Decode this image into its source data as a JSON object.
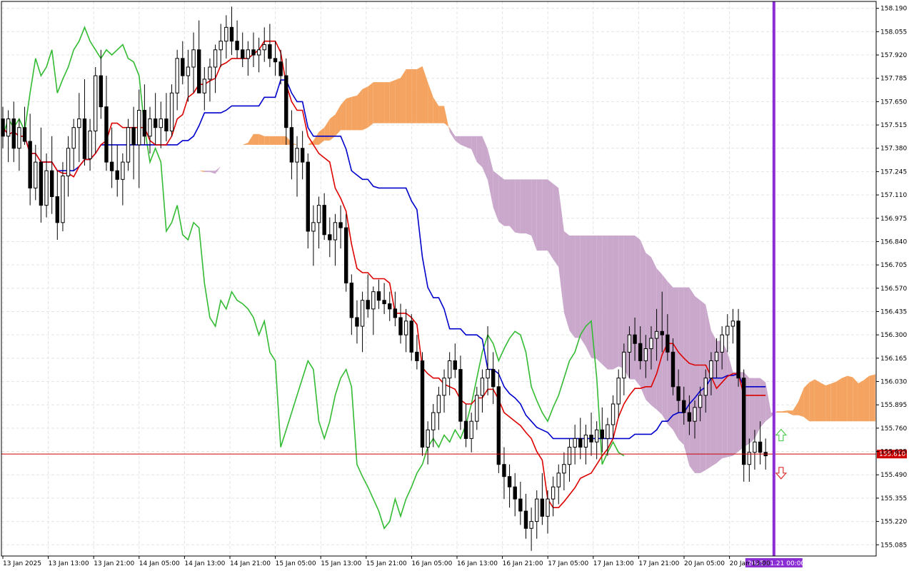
{
  "chart_data": {
    "type": "candlestick",
    "symbol_note": "",
    "y_axis": {
      "min": 155.02,
      "max": 158.23,
      "ticks": [
        "158.190",
        "158.055",
        "157.920",
        "157.785",
        "157.650",
        "157.515",
        "157.380",
        "157.245",
        "157.110",
        "156.975",
        "156.840",
        "156.705",
        "156.570",
        "156.435",
        "156.300",
        "156.165",
        "156.030",
        "155.895",
        "155.760",
        "155.625",
        "155.490",
        "155.355",
        "155.220",
        "155.085"
      ]
    },
    "x_axis": {
      "ticks": [
        "13 Jan 2025",
        "13 Jan 13:00",
        "13 Jan 21:00",
        "14 Jan 05:00",
        "14 Jan 13:00",
        "14 Jan 21:00",
        "15 Jan 05:00",
        "15 Jan 13:00",
        "15 Jan 21:00",
        "16 Jan 05:00",
        "16 Jan 13:00",
        "16 Jan 21:00",
        "17 Jan 05:00",
        "17 Jan 13:00",
        "17 Jan 21:00",
        "20 Jan 05:00",
        "20 Jan 13:00"
      ]
    },
    "current_price": "155.610",
    "current_price_color": "#cc0000",
    "future_marker": {
      "label": "2025.01.21 00:00",
      "color": "#8b2fd4"
    },
    "grid": true,
    "colors": {
      "bull_candle": "#ffffff",
      "bear_candle": "#000000",
      "tenkan": "#dd0000",
      "kijun": "#0000cc",
      "chikou": "#33bb33",
      "cloud_bear": "#c9a8cc",
      "cloud_bull": "#f4a460",
      "arrow_up": "#55cc55",
      "arrow_down": "#dd3333"
    },
    "candles": [
      [
        157.55,
        157.62,
        157.38,
        157.45
      ],
      [
        157.45,
        157.6,
        157.3,
        157.55
      ],
      [
        157.55,
        157.65,
        157.3,
        157.38
      ],
      [
        157.38,
        157.55,
        157.25,
        157.5
      ],
      [
        157.5,
        157.62,
        157.4,
        157.42
      ],
      [
        157.42,
        157.58,
        157.05,
        157.15
      ],
      [
        157.15,
        157.4,
        157.08,
        157.3
      ],
      [
        157.3,
        157.5,
        156.95,
        157.05
      ],
      [
        157.05,
        157.35,
        156.98,
        157.25
      ],
      [
        157.25,
        157.45,
        157.0,
        157.1
      ],
      [
        157.1,
        157.25,
        156.85,
        156.95
      ],
      [
        156.95,
        157.3,
        156.9,
        157.22
      ],
      [
        157.22,
        157.45,
        157.1,
        157.38
      ],
      [
        157.38,
        157.55,
        157.25,
        157.5
      ],
      [
        157.5,
        157.7,
        157.3,
        157.55
      ],
      [
        157.55,
        157.78,
        157.28,
        157.32
      ],
      [
        157.32,
        157.55,
        157.25,
        157.48
      ],
      [
        157.48,
        157.85,
        157.35,
        157.8
      ],
      [
        157.8,
        157.95,
        157.55,
        157.62
      ],
      [
        157.62,
        157.8,
        157.25,
        157.3
      ],
      [
        157.3,
        157.5,
        157.15,
        157.25
      ],
      [
        157.25,
        157.4,
        157.1,
        157.2
      ],
      [
        157.2,
        157.35,
        157.05,
        157.3
      ],
      [
        157.3,
        157.55,
        157.25,
        157.5
      ],
      [
        157.5,
        157.62,
        157.2,
        157.4
      ],
      [
        157.4,
        157.72,
        157.15,
        157.6
      ],
      [
        157.6,
        157.75,
        157.4,
        157.45
      ],
      [
        157.45,
        157.62,
        157.35,
        157.55
      ],
      [
        157.55,
        157.7,
        157.4,
        157.5
      ],
      [
        157.5,
        157.65,
        157.38,
        157.55
      ],
      [
        157.55,
        157.7,
        157.42,
        157.48
      ],
      [
        157.48,
        157.75,
        157.45,
        157.7
      ],
      [
        157.7,
        157.95,
        157.6,
        157.9
      ],
      [
        157.9,
        158.0,
        157.75,
        157.8
      ],
      [
        157.8,
        157.95,
        157.65,
        157.85
      ],
      [
        157.85,
        158.05,
        157.7,
        157.95
      ],
      [
        157.95,
        158.12,
        157.8,
        157.7
      ],
      [
        157.7,
        157.85,
        157.6,
        157.78
      ],
      [
        157.78,
        157.9,
        157.65,
        157.85
      ],
      [
        157.85,
        157.98,
        157.7,
        157.95
      ],
      [
        157.95,
        158.1,
        157.85,
        158.0
      ],
      [
        158.0,
        158.15,
        157.9,
        158.08
      ],
      [
        158.08,
        158.2,
        157.92,
        158.0
      ],
      [
        158.0,
        158.12,
        157.9,
        157.95
      ],
      [
        157.95,
        158.05,
        157.85,
        157.9
      ],
      [
        157.9,
        158.0,
        157.8,
        157.95
      ],
      [
        157.95,
        158.05,
        157.85,
        157.92
      ],
      [
        157.92,
        158.02,
        157.82,
        157.95
      ],
      [
        157.95,
        158.08,
        157.88,
        157.98
      ],
      [
        157.98,
        158.1,
        157.85,
        157.9
      ],
      [
        157.9,
        158.0,
        157.8,
        157.88
      ],
      [
        157.88,
        157.95,
        157.75,
        157.8
      ],
      [
        157.8,
        157.9,
        157.4,
        157.5
      ],
      [
        157.5,
        157.6,
        157.2,
        157.3
      ],
      [
        157.3,
        157.45,
        157.1,
        157.38
      ],
      [
        157.38,
        157.48,
        157.2,
        157.3
      ],
      [
        157.3,
        157.35,
        156.8,
        156.9
      ],
      [
        156.9,
        157.05,
        156.7,
        156.95
      ],
      [
        156.95,
        157.1,
        156.8,
        157.05
      ],
      [
        157.05,
        157.12,
        156.85,
        156.88
      ],
      [
        156.88,
        156.98,
        156.75,
        156.85
      ],
      [
        156.85,
        157.0,
        156.7,
        156.95
      ],
      [
        156.95,
        157.05,
        156.8,
        156.92
      ],
      [
        156.92,
        157.0,
        156.55,
        156.6
      ],
      [
        156.6,
        156.65,
        156.3,
        156.4
      ],
      [
        156.4,
        156.5,
        156.25,
        156.35
      ],
      [
        156.35,
        156.55,
        156.2,
        156.5
      ],
      [
        156.5,
        156.65,
        156.4,
        156.45
      ],
      [
        156.45,
        156.58,
        156.3,
        156.55
      ],
      [
        156.55,
        156.62,
        156.45,
        156.5
      ],
      [
        156.5,
        156.6,
        156.42,
        156.48
      ],
      [
        156.48,
        156.55,
        156.38,
        156.45
      ],
      [
        156.45,
        156.55,
        156.35,
        156.4
      ],
      [
        156.4,
        156.48,
        156.25,
        156.3
      ],
      [
        156.3,
        156.45,
        156.2,
        156.38
      ],
      [
        156.38,
        156.42,
        156.15,
        156.2
      ],
      [
        156.2,
        156.3,
        156.1,
        156.15
      ],
      [
        156.15,
        156.2,
        155.6,
        155.65
      ],
      [
        155.65,
        155.8,
        155.55,
        155.75
      ],
      [
        155.75,
        155.9,
        155.65,
        155.85
      ],
      [
        155.85,
        156.0,
        155.75,
        155.95
      ],
      [
        155.95,
        156.1,
        155.85,
        156.05
      ],
      [
        156.05,
        156.2,
        155.95,
        156.15
      ],
      [
        156.15,
        156.25,
        156.05,
        156.1
      ],
      [
        156.1,
        156.18,
        155.75,
        155.8
      ],
      [
        155.8,
        155.9,
        155.65,
        155.7
      ],
      [
        155.7,
        155.85,
        155.62,
        155.8
      ],
      [
        155.8,
        156.0,
        155.75,
        155.95
      ],
      [
        155.95,
        156.1,
        155.85,
        156.05
      ],
      [
        156.05,
        156.35,
        155.95,
        156.1
      ],
      [
        156.1,
        156.2,
        155.9,
        156.0
      ],
      [
        156.0,
        156.1,
        155.5,
        155.55
      ],
      [
        155.55,
        155.65,
        155.35,
        155.48
      ],
      [
        155.48,
        155.55,
        155.3,
        155.42
      ],
      [
        155.42,
        155.5,
        155.25,
        155.35
      ],
      [
        155.35,
        155.45,
        155.2,
        155.28
      ],
      [
        155.28,
        155.38,
        155.12,
        155.18
      ],
      [
        155.18,
        155.3,
        155.05,
        155.22
      ],
      [
        155.22,
        155.4,
        155.12,
        155.35
      ],
      [
        155.35,
        155.5,
        155.2,
        155.25
      ],
      [
        155.25,
        155.4,
        155.15,
        155.35
      ],
      [
        155.35,
        155.48,
        155.25,
        155.42
      ],
      [
        155.42,
        155.55,
        155.32,
        155.5
      ],
      [
        155.5,
        155.62,
        155.4,
        155.55
      ],
      [
        155.55,
        155.7,
        155.45,
        155.65
      ],
      [
        155.65,
        155.78,
        155.55,
        155.7
      ],
      [
        155.7,
        155.82,
        155.58,
        155.65
      ],
      [
        155.65,
        155.78,
        155.55,
        155.72
      ],
      [
        155.72,
        155.85,
        155.6,
        155.68
      ],
      [
        155.68,
        155.8,
        155.58,
        155.75
      ],
      [
        155.75,
        155.88,
        155.62,
        155.7
      ],
      [
        155.7,
        155.82,
        155.6,
        155.78
      ],
      [
        155.78,
        155.95,
        155.7,
        155.9
      ],
      [
        155.9,
        156.1,
        155.82,
        156.05
      ],
      [
        156.05,
        156.25,
        155.95,
        156.2
      ],
      [
        156.2,
        156.35,
        156.05,
        156.3
      ],
      [
        156.3,
        156.4,
        156.15,
        156.25
      ],
      [
        156.25,
        156.35,
        156.1,
        156.15
      ],
      [
        156.15,
        156.3,
        156.05,
        156.22
      ],
      [
        156.22,
        156.35,
        156.1,
        156.28
      ],
      [
        156.28,
        156.45,
        156.15,
        156.32
      ],
      [
        156.32,
        156.55,
        156.2,
        156.3
      ],
      [
        156.3,
        156.42,
        156.15,
        156.2
      ],
      [
        156.2,
        156.28,
        155.95,
        156.0
      ],
      [
        156.0,
        156.1,
        155.85,
        155.92
      ],
      [
        155.92,
        156.0,
        155.78,
        155.85
      ],
      [
        155.85,
        155.95,
        155.72,
        155.8
      ],
      [
        155.8,
        155.92,
        155.7,
        155.88
      ],
      [
        155.88,
        156.0,
        155.8,
        155.95
      ],
      [
        155.95,
        156.1,
        155.85,
        156.05
      ],
      [
        156.05,
        156.2,
        155.95,
        156.15
      ],
      [
        156.15,
        156.28,
        156.05,
        156.2
      ],
      [
        156.2,
        156.35,
        156.1,
        156.3
      ],
      [
        156.3,
        156.42,
        156.2,
        156.35
      ],
      [
        156.35,
        156.45,
        156.25,
        156.38
      ],
      [
        156.38,
        156.45,
        156.0,
        156.05
      ],
      [
        156.05,
        156.1,
        155.45,
        155.55
      ],
      [
        155.55,
        155.7,
        155.45,
        155.62
      ],
      [
        155.62,
        155.75,
        155.52,
        155.68
      ],
      [
        155.68,
        155.8,
        155.55,
        155.62
      ],
      [
        155.62,
        155.7,
        155.52,
        155.6
      ]
    ]
  }
}
